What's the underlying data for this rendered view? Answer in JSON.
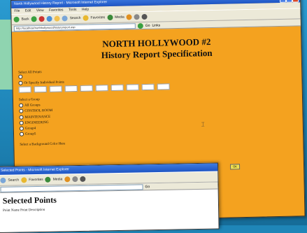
{
  "main_window": {
    "title": "North Hollywood History Report - Microsoft Internet Explorer",
    "menu": [
      "File",
      "Edit",
      "View",
      "Favorites",
      "Tools",
      "Help"
    ],
    "toolbar": {
      "back_label": "Back",
      "search_label": "Search",
      "favorites_label": "Favorites",
      "media_label": "Media"
    },
    "address": "http://localhost/northhollywood/historyreport.asp",
    "go_label": "Go",
    "links_label": "Links",
    "heading_line1": "NORTH HOLLYWOOD     #2",
    "heading_line2": "History Report Specification",
    "select_all_points": "Select All Points",
    "or_specify": "Or Specify Individual Points",
    "select_group": "Select a Group",
    "groups": [
      "All Groups",
      "CONTROL ROOM",
      "MAINTENANCE",
      "ENGINEERING",
      "Group4",
      "Group5"
    ],
    "bg_color_label": "Select a Background Color Here",
    "ok_label": "OK"
  },
  "second_window": {
    "title": "Selected Points - Microsoft Internet Explorer",
    "toolbar": {
      "search_label": "Search",
      "favorites_label": "Favorites",
      "media_label": "Media"
    },
    "go_label": "Go",
    "heading": "Selected Points",
    "subheading": "Point Name  Point Description"
  },
  "colors": {
    "page_background": "#1f86b8",
    "report_background": "#f4a21f",
    "titlebar": "#2360d0"
  }
}
